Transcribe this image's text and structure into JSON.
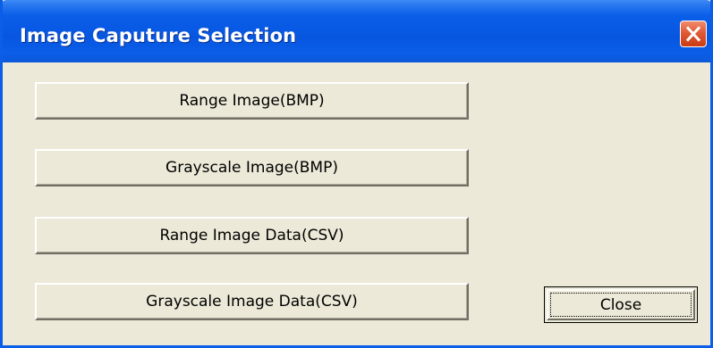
{
  "window": {
    "title": "Image Caputure Selection"
  },
  "titlebar": {
    "close_icon": "close-x-icon",
    "close_color": "#e05a36",
    "color": "#0a5ee8"
  },
  "buttons": {
    "range_bmp": "Range Image(BMP)",
    "gray_bmp": "Grayscale Image(BMP)",
    "range_csv": "Range Image Data(CSV)",
    "gray_csv": "Grayscale Image Data(CSV)",
    "close": "Close"
  },
  "colors": {
    "face": "#ece9d8"
  }
}
